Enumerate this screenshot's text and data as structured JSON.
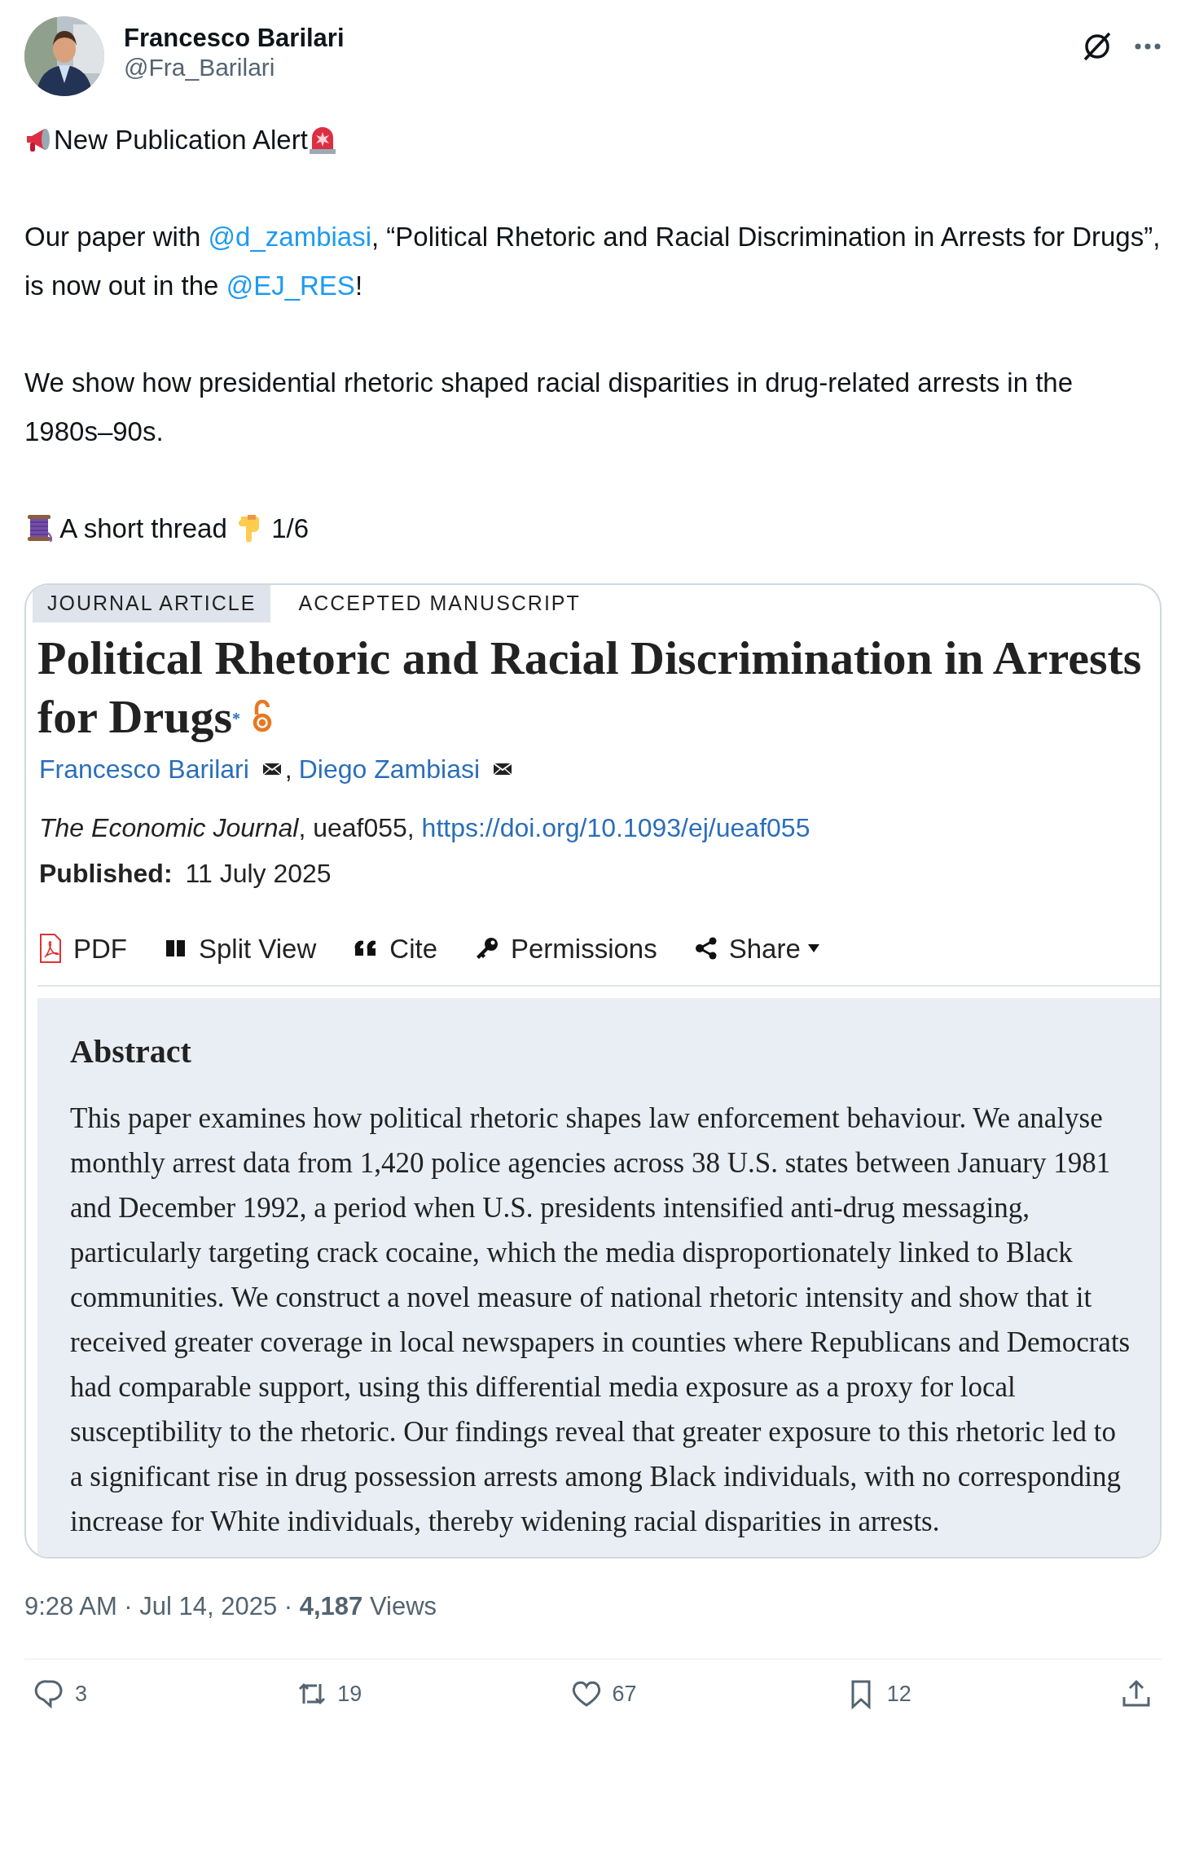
{
  "author": {
    "name": "Francesco Barilari",
    "handle": "@Fra_Barilari"
  },
  "post": [
    {
      "kind": "alert",
      "segments": [
        {
          "kind": "text",
          "text": "New Publication Alert"
        }
      ]
    },
    {
      "kind": "plain",
      "segments": [
        {
          "kind": "text",
          "text": "Our paper with "
        },
        {
          "kind": "mention",
          "text": "@d_zambiasi"
        },
        {
          "kind": "text",
          "text": ", “Political Rhetoric and Racial Discrimination in Arrests for Drugs”, is now out in the "
        },
        {
          "kind": "mention",
          "text": "@EJ_RES"
        },
        {
          "kind": "text",
          "text": "!"
        }
      ]
    },
    {
      "kind": "plain",
      "segments": [
        {
          "kind": "text",
          "text": "We show how presidential rhetoric shaped racial disparities in drug-related arrests in the 1980s–90s."
        }
      ]
    },
    {
      "kind": "thread",
      "segments": [
        {
          "kind": "text",
          "text": "A short thread"
        },
        {
          "kind": "text",
          "text": "1/6"
        }
      ]
    }
  ],
  "article": {
    "tags": [
      {
        "label": "JOURNAL ARTICLE",
        "shaded": true
      },
      {
        "label": "ACCEPTED MANUSCRIPT",
        "shaded": false
      }
    ],
    "title": "Political Rhetoric and Racial Discrimination in Arrests for Drugs$^{*}$",
    "authors": [
      {
        "name": "Francesco Barilari"
      },
      {
        "name": "Diego Zambiasi"
      }
    ],
    "author_separator": ",",
    "citation": "*The Economic Journal*, ueaf055, ",
    "doi": "https://doi.org/10.1093/ej/ueaf055",
    "published_label": "Published:",
    "published_date": "11 July 2025",
    "toolbar": [
      {
        "kind": "pdf",
        "label": "PDF",
        "dropdown": false
      },
      {
        "kind": "split",
        "label": "Split View",
        "dropdown": false
      },
      {
        "kind": "cite",
        "label": "Cite",
        "dropdown": false
      },
      {
        "kind": "key",
        "label": "Permissions",
        "dropdown": false
      },
      {
        "kind": "share",
        "label": "Share",
        "dropdown": true
      }
    ],
    "abstract_heading": "Abstract",
    "abstract": "This paper examines how political rhetoric shapes law enforcement behaviour. We analyse monthly arrest data from 1,420 police agencies across 38 U.S. states between January 1981 and December 1992, a period when U.S. presidents intensified anti-drug messaging, particularly targeting crack cocaine, which the media disproportionately linked to Black communities. We construct a novel measure of national rhetoric intensity and show that it received greater coverage in local newspapers in counties where Republicans and Democrats had comparable support, using this differential media exposure as a proxy for local susceptibility to the rhetoric. Our findings reveal that greater exposure to this rhetoric led to a significant rise in drug possession arrests among Black individuals, with no corresponding increase for White individuals, thereby widening racial disparities in arrests."
  },
  "meta": "9:28 AM · Jul 14, 2025 · **4,187** Views",
  "actions": [
    {
      "kind": "reply",
      "count": "3"
    },
    {
      "kind": "repost",
      "count": "19"
    },
    {
      "kind": "like",
      "count": "67"
    },
    {
      "kind": "bookmark",
      "count": "12"
    },
    {
      "kind": "share"
    }
  ]
}
